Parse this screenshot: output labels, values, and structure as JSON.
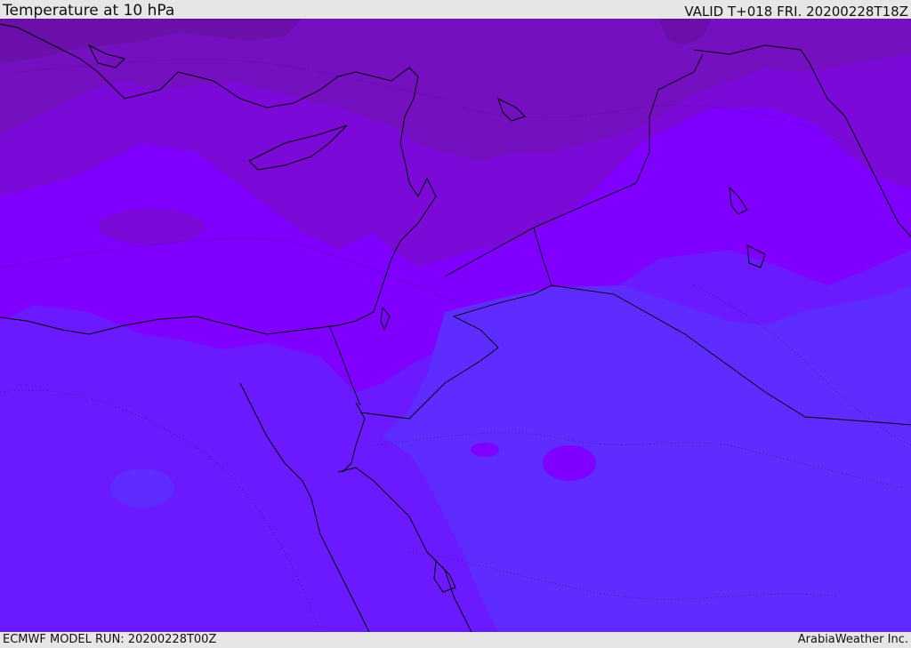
{
  "header": {
    "title": "Temperature at 10 hPa",
    "valid": "VALID T+018 FRI. 20200228T18Z"
  },
  "footer": {
    "model_run": "ECMWF MODEL RUN: 20200228T00Z",
    "credit": "ArabiaWeather Inc."
  },
  "map": {
    "field": "temperature",
    "level": "10 hPa",
    "colors": {
      "darkest": "#6a0fa9",
      "dark": "#7410bf",
      "mid_dark": "#7b09d8",
      "violet": "#7f00ff",
      "blue_violet": "#6b1aff",
      "blue": "#5f2cff",
      "coastline": "#000000"
    }
  }
}
